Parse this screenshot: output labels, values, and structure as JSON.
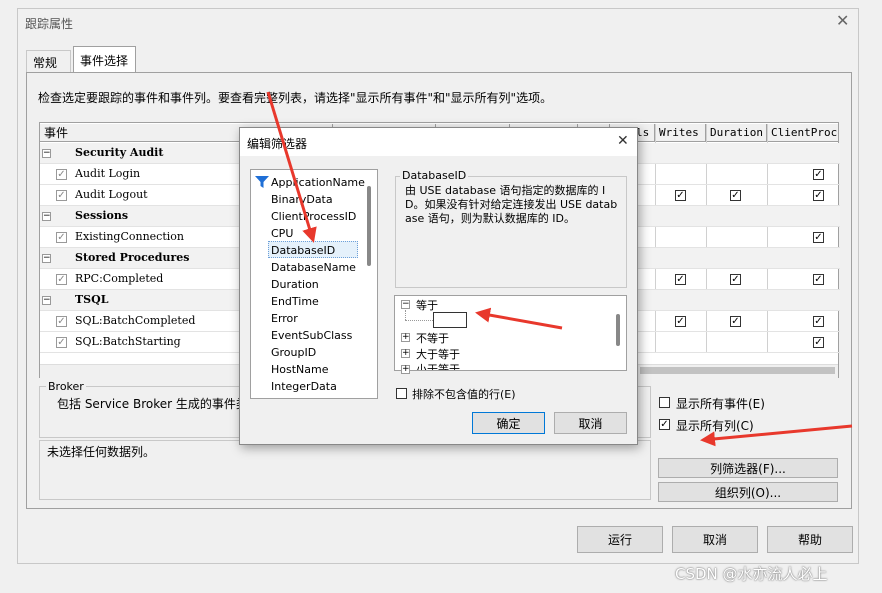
{
  "window": {
    "title": "跟踪属性"
  },
  "tabs": [
    {
      "label": "常规"
    },
    {
      "label": "事件选择"
    }
  ],
  "instructions": "检查选定要跟踪的事件和事件列。要查看完整列表，请选择\"显示所有事件\"和\"显示所有列\"选项。",
  "grid": {
    "headers": {
      "events": "事件",
      "h6": "ls",
      "writes": "Writes",
      "duration": "Duration",
      "client": "ClientProce"
    },
    "categories": {
      "security": "Security Audit",
      "sessions": "Sessions",
      "stored": "Stored Procedures",
      "tsql": "TSQL"
    },
    "events": {
      "audit_login": "Audit Login",
      "audit_logout": "Audit Logout",
      "existing_connection": "ExistingConnection",
      "rpc_completed": "RPC:Completed",
      "sql_batch_completed": "SQL:BatchCompleted",
      "sql_batch_starting": "SQL:BatchStarting"
    }
  },
  "broker": {
    "label": "Broker",
    "description": "包括 Service Broker 生成的事件类。"
  },
  "columns_info": "未选择任何数据列。",
  "options": {
    "show_all_events": "显示所有事件(E)",
    "show_all_columns": "显示所有列(C)"
  },
  "buttons": {
    "column_filter": "列筛选器(F)...",
    "organize_columns": "组织列(O)...",
    "run": "运行",
    "cancel": "取消",
    "help": "帮助"
  },
  "filter_dialog": {
    "title": "编辑筛选器",
    "columns": [
      "ApplicationName",
      "BinaryData",
      "ClientProcessID",
      "CPU",
      "DatabaseID",
      "DatabaseName",
      "Duration",
      "EndTime",
      "Error",
      "EventSubClass",
      "GroupID",
      "HostName",
      "IntegerData"
    ],
    "description_title": "DatabaseID",
    "description": "由 USE database 语句指定的数据库的 ID。如果没有针对给定连接发出 USE database 语句，则为默认数据库的 ID。",
    "operators": [
      "等于",
      "不等于",
      "大于等于",
      "小于等于"
    ],
    "exclude_label": "排除不包含值的行(E)",
    "ok": "确定",
    "cancel": "取消"
  },
  "watermark": "CSDN @水亦流人必上",
  "colors": {
    "arrow": "#e8382c",
    "filter_icon": "#1f6fd6",
    "selection": "#e5f1fb"
  }
}
